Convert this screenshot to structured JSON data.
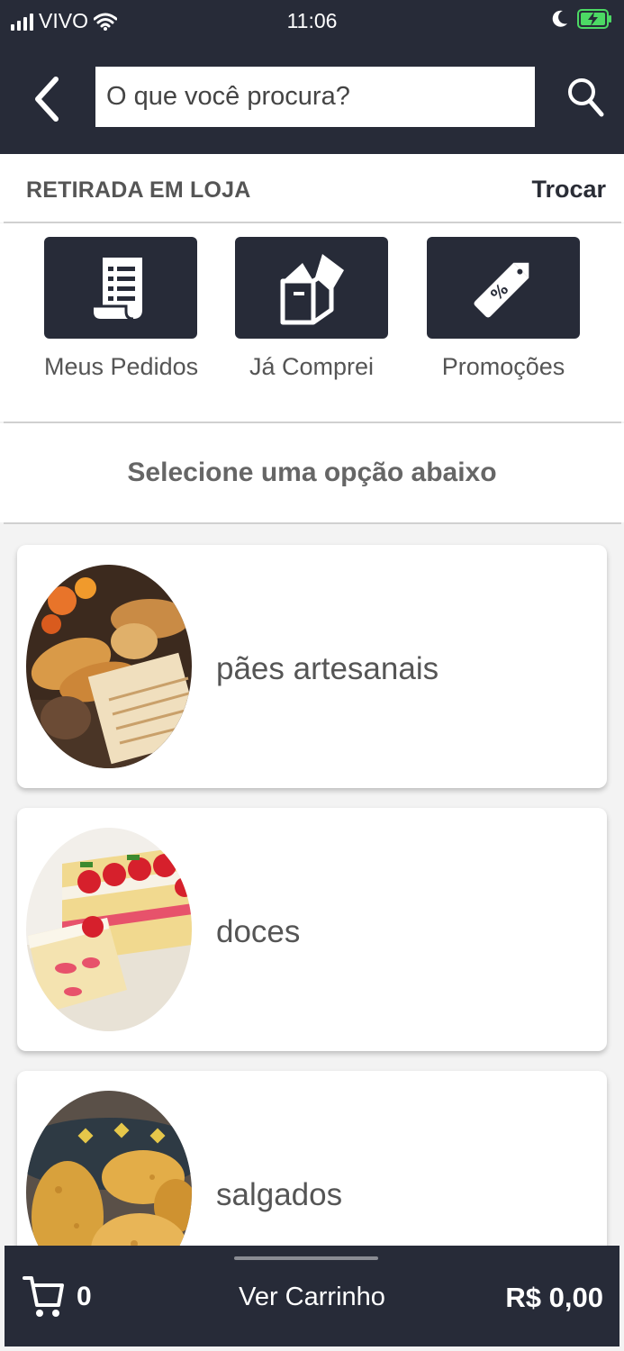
{
  "status_bar": {
    "carrier": "VIVO",
    "time": "11:06"
  },
  "header": {
    "search_placeholder": "O que você procura?"
  },
  "pickup": {
    "label": "RETIRADA EM LOJA",
    "change": "Trocar"
  },
  "quick_actions": [
    {
      "label": "Meus Pedidos",
      "icon": "receipt-icon"
    },
    {
      "label": "Já Comprei",
      "icon": "open-box-icon"
    },
    {
      "label": "Promoções",
      "icon": "price-tag-icon"
    }
  ],
  "section_title": "Selecione uma opção abaixo",
  "categories": [
    {
      "label": "pães artesanais",
      "image": "bread-photo"
    },
    {
      "label": "doces",
      "image": "cake-photo"
    },
    {
      "label": "salgados",
      "image": "savory-snacks-photo"
    }
  ],
  "cart": {
    "count": "0",
    "view_label": "Ver Carrinho",
    "total": "R$ 0,00"
  },
  "colors": {
    "dark": "#272b38",
    "battery": "#4cd964"
  }
}
